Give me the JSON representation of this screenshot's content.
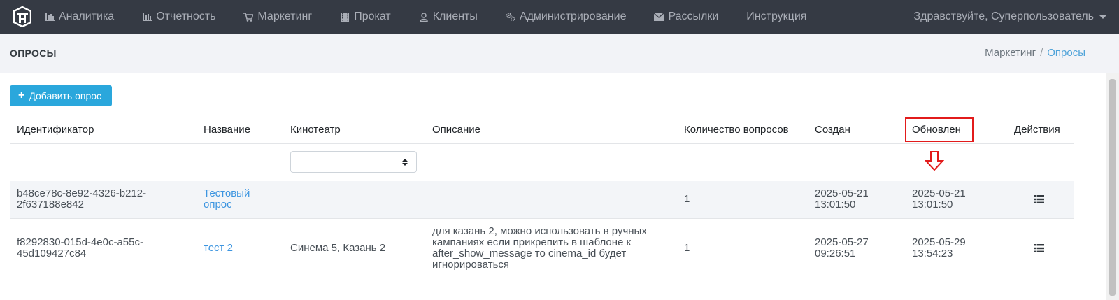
{
  "topnav": {
    "items": [
      {
        "label": "Аналитика",
        "icon": "bar-chart-icon"
      },
      {
        "label": "Отчетность",
        "icon": "bar-chart-icon"
      },
      {
        "label": "Маркетинг",
        "icon": "cart-icon"
      },
      {
        "label": "Прокат",
        "icon": "film-icon"
      },
      {
        "label": "Клиенты",
        "icon": "user-icon"
      },
      {
        "label": "Администрирование",
        "icon": "cogs-icon"
      },
      {
        "label": "Рассылки",
        "icon": "envelope-icon"
      },
      {
        "label": "Инструкция",
        "icon": ""
      }
    ],
    "greeting": "Здравствуйте, Суперпользователь"
  },
  "header": {
    "title": "ОПРОСЫ",
    "breadcrumb": [
      "Маркетинг",
      "Опросы"
    ],
    "breadcrumb_separator": "/"
  },
  "toolbar": {
    "add_label": "Добавить опрос"
  },
  "table": {
    "columns": [
      "Идентификатор",
      "Название",
      "Кинотеатр",
      "Описание",
      "Количество вопросов",
      "Создан",
      "Обновлен",
      "Действия"
    ],
    "filter_cinema_value": "",
    "rows": [
      {
        "id_line1": "b48ce78c-8e92-4326-b212-",
        "id_line2": "2f637188e842",
        "name_line1": "Тестовый",
        "name_line2": "опрос",
        "cinema": "",
        "description": [
          "",
          "",
          "",
          ""
        ],
        "questions": "1",
        "created_date": "2025-05-21",
        "created_time": "13:01:50",
        "updated_date": "2025-05-21",
        "updated_time": "13:01:50"
      },
      {
        "id_line1": "f8292830-015d-4e0c-a55c-",
        "id_line2": "45d109427c84",
        "name_line1": "тест 2",
        "name_line2": "",
        "cinema": "Синема 5, Казань 2",
        "description": [
          "для казань 2, можно использовать в ручных",
          "кампаниях если прикрепить в шаблоне к",
          "after_show_message то cinema_id будет",
          "игнорироваться"
        ],
        "questions": "1",
        "created_date": "2025-05-27",
        "created_time": "09:26:51",
        "updated_date": "2025-05-29",
        "updated_time": "13:54:23"
      }
    ]
  },
  "annotation": {
    "highlight_color": "#e21b1b",
    "highlighted_column": "Обновлен"
  }
}
